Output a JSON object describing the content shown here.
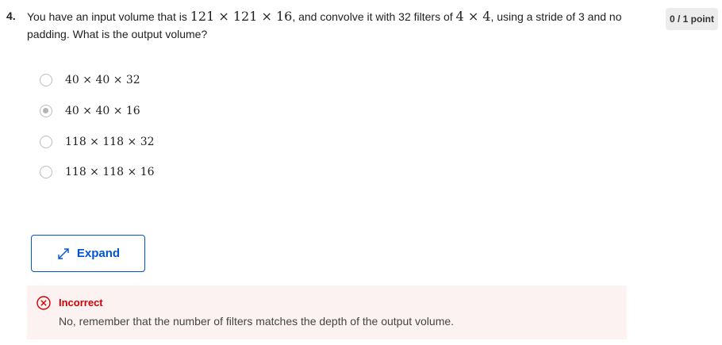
{
  "question": {
    "number": "4.",
    "text_1": "You have an input volume that is ",
    "math_1": "121 × 121 × 16",
    "text_2": ", and convolve it with 32 filters of ",
    "math_2": "4 × 4",
    "text_3": ", using a stride of 3 and no padding. What is the output volume?",
    "points": "0 / 1 point"
  },
  "options": [
    {
      "label": "40 × 40 × 32",
      "selected": false
    },
    {
      "label": "40 × 40 × 16",
      "selected": true
    },
    {
      "label": "118 × 118 × 32",
      "selected": false
    },
    {
      "label": "118 × 118 × 16",
      "selected": false
    }
  ],
  "expand": {
    "label": "Expand",
    "icon": "expand-arrows-icon"
  },
  "feedback": {
    "status": "Incorrect",
    "message": "No, remember that the number of filters matches the depth of the output volume.",
    "color": "#d30001",
    "icon": "x-circle-icon"
  }
}
